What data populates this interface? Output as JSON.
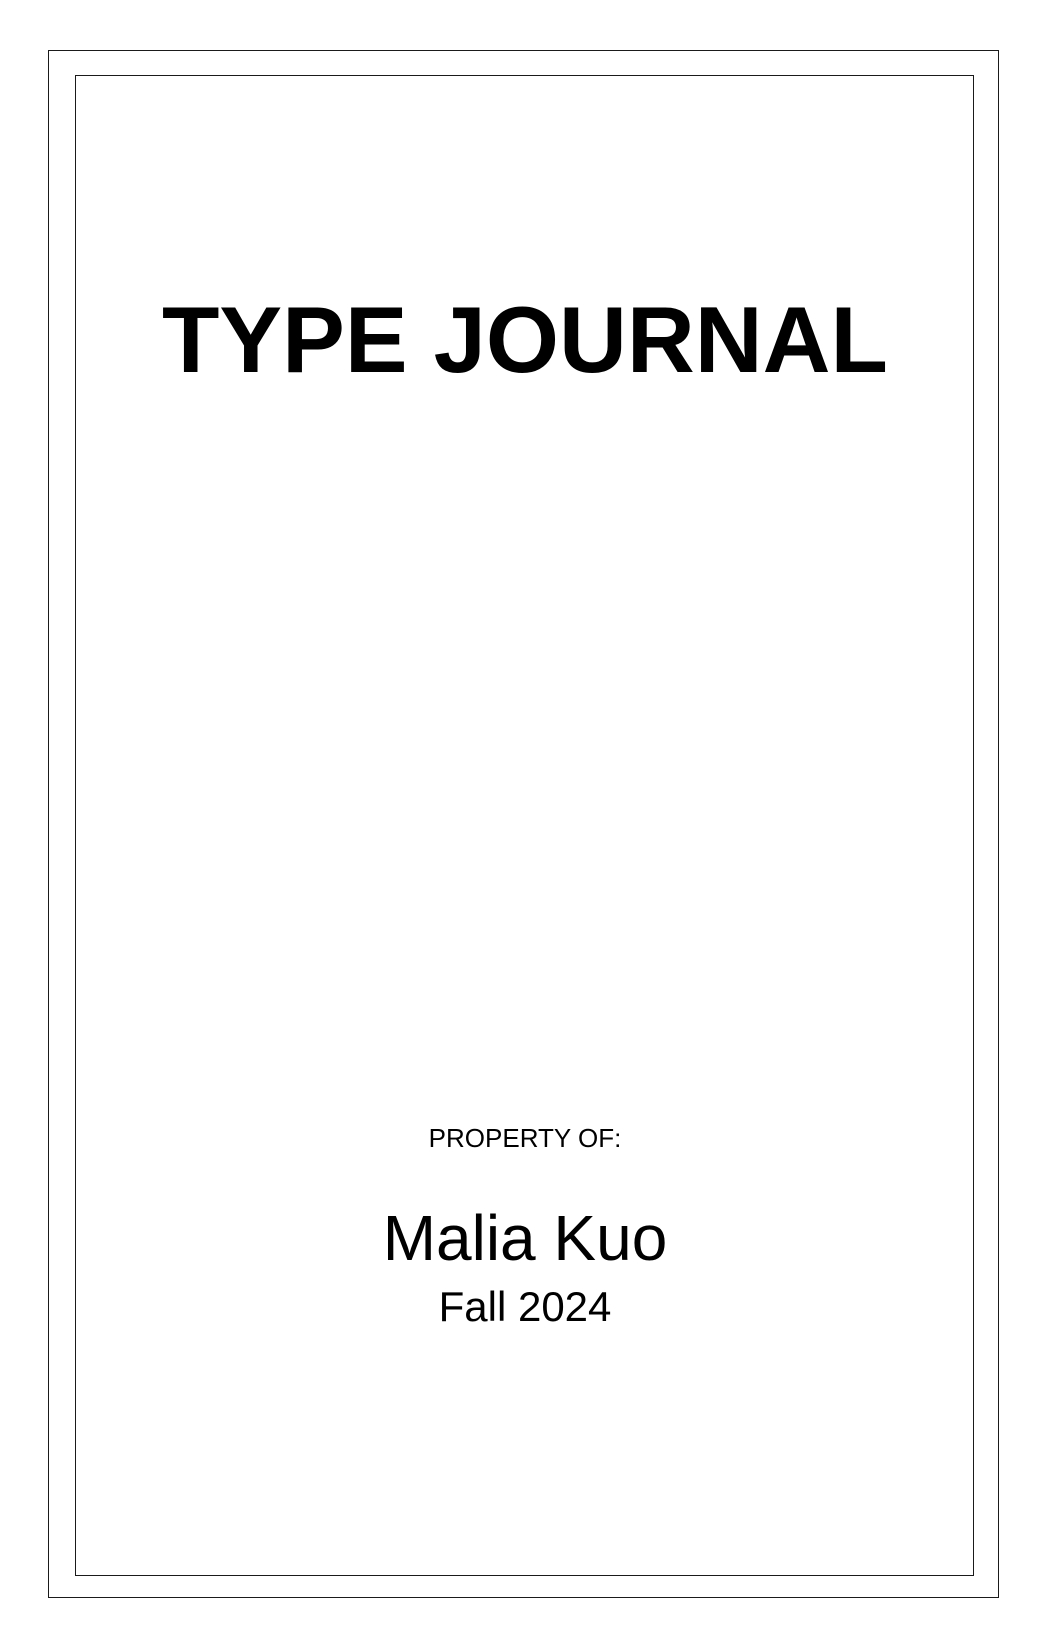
{
  "cover": {
    "title": "TYPE JOURNAL",
    "property_label": "PROPERTY OF:",
    "owner_name": "Malia Kuo",
    "term": "Fall 2024"
  },
  "colors": {
    "background": "#ffffff",
    "text": "#000000",
    "border": "#1a1a1a"
  }
}
